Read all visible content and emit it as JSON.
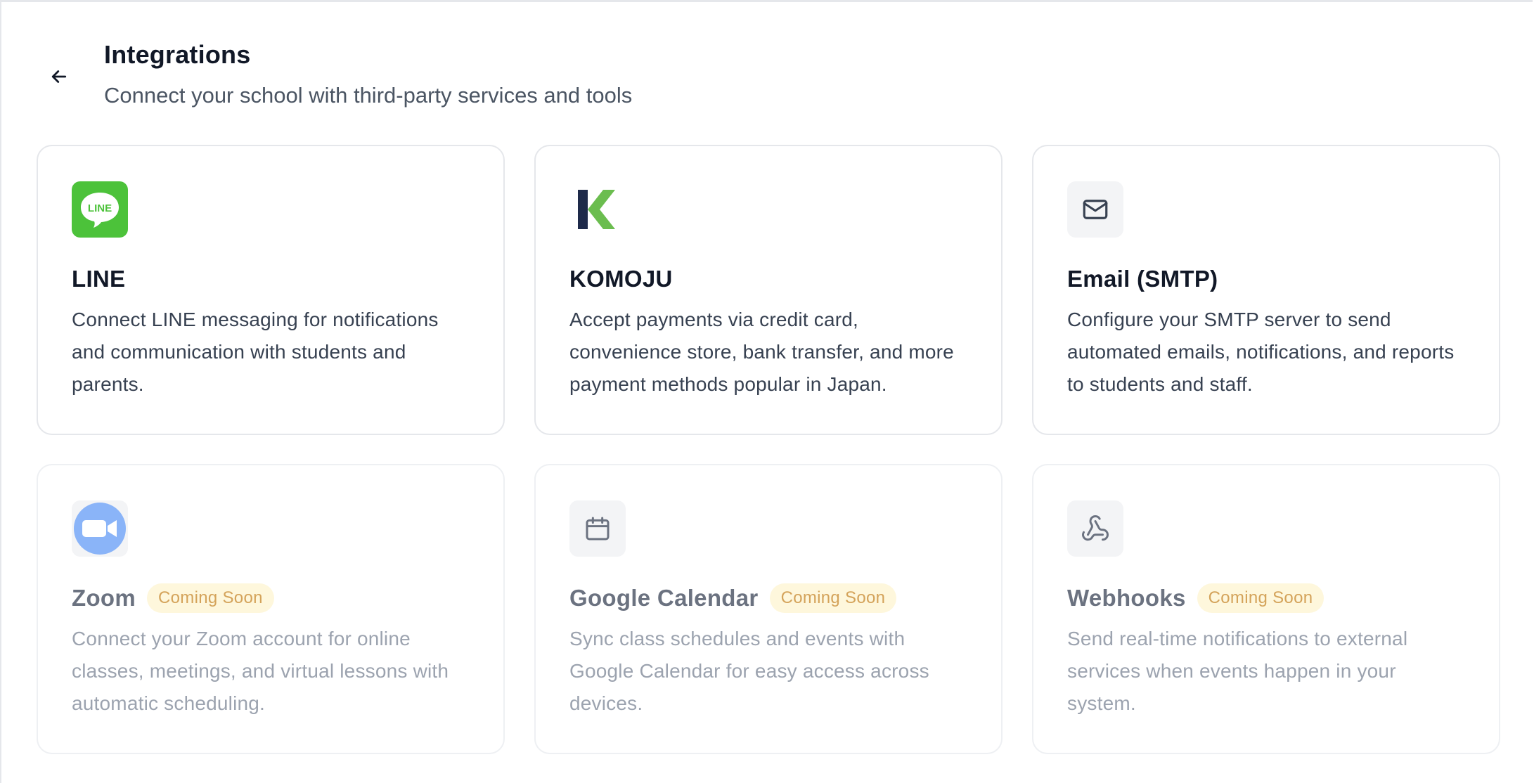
{
  "header": {
    "title": "Integrations",
    "subtitle": "Connect your school with third-party services and tools"
  },
  "colors": {
    "line_green": "#4cc23a",
    "komoju_navy": "#1e2a4a",
    "komoju_green": "#6bbd4f",
    "zoom_blue": "#8ab4f8",
    "badge_bg": "#fef7dc",
    "badge_text": "#d4a35a"
  },
  "cards": [
    {
      "icon": "line-logo",
      "icon_text": "LINE",
      "title": "LINE",
      "description": "Connect LINE messaging for notifications and communication with students and parents.",
      "badge": ""
    },
    {
      "icon": "komoju-logo",
      "title": "KOMOJU",
      "description": "Accept payments via credit card, convenience store, bank transfer, and more payment methods popular in Japan.",
      "badge": ""
    },
    {
      "icon": "mail-icon",
      "title": "Email (SMTP)",
      "description": "Configure your SMTP server to send automated emails, notifications, and reports to students and staff.",
      "badge": ""
    },
    {
      "icon": "zoom-logo",
      "title": "Zoom",
      "description": "Connect your Zoom account for online classes, meetings, and virtual lessons with automatic scheduling.",
      "badge": "Coming Soon"
    },
    {
      "icon": "calendar-icon",
      "title": "Google Calendar",
      "description": "Sync class schedules and events with Google Calendar for easy access across devices.",
      "badge": "Coming Soon"
    },
    {
      "icon": "webhook-icon",
      "title": "Webhooks",
      "description": "Send real-time notifications to external services when events happen in your system.",
      "badge": "Coming Soon"
    }
  ]
}
